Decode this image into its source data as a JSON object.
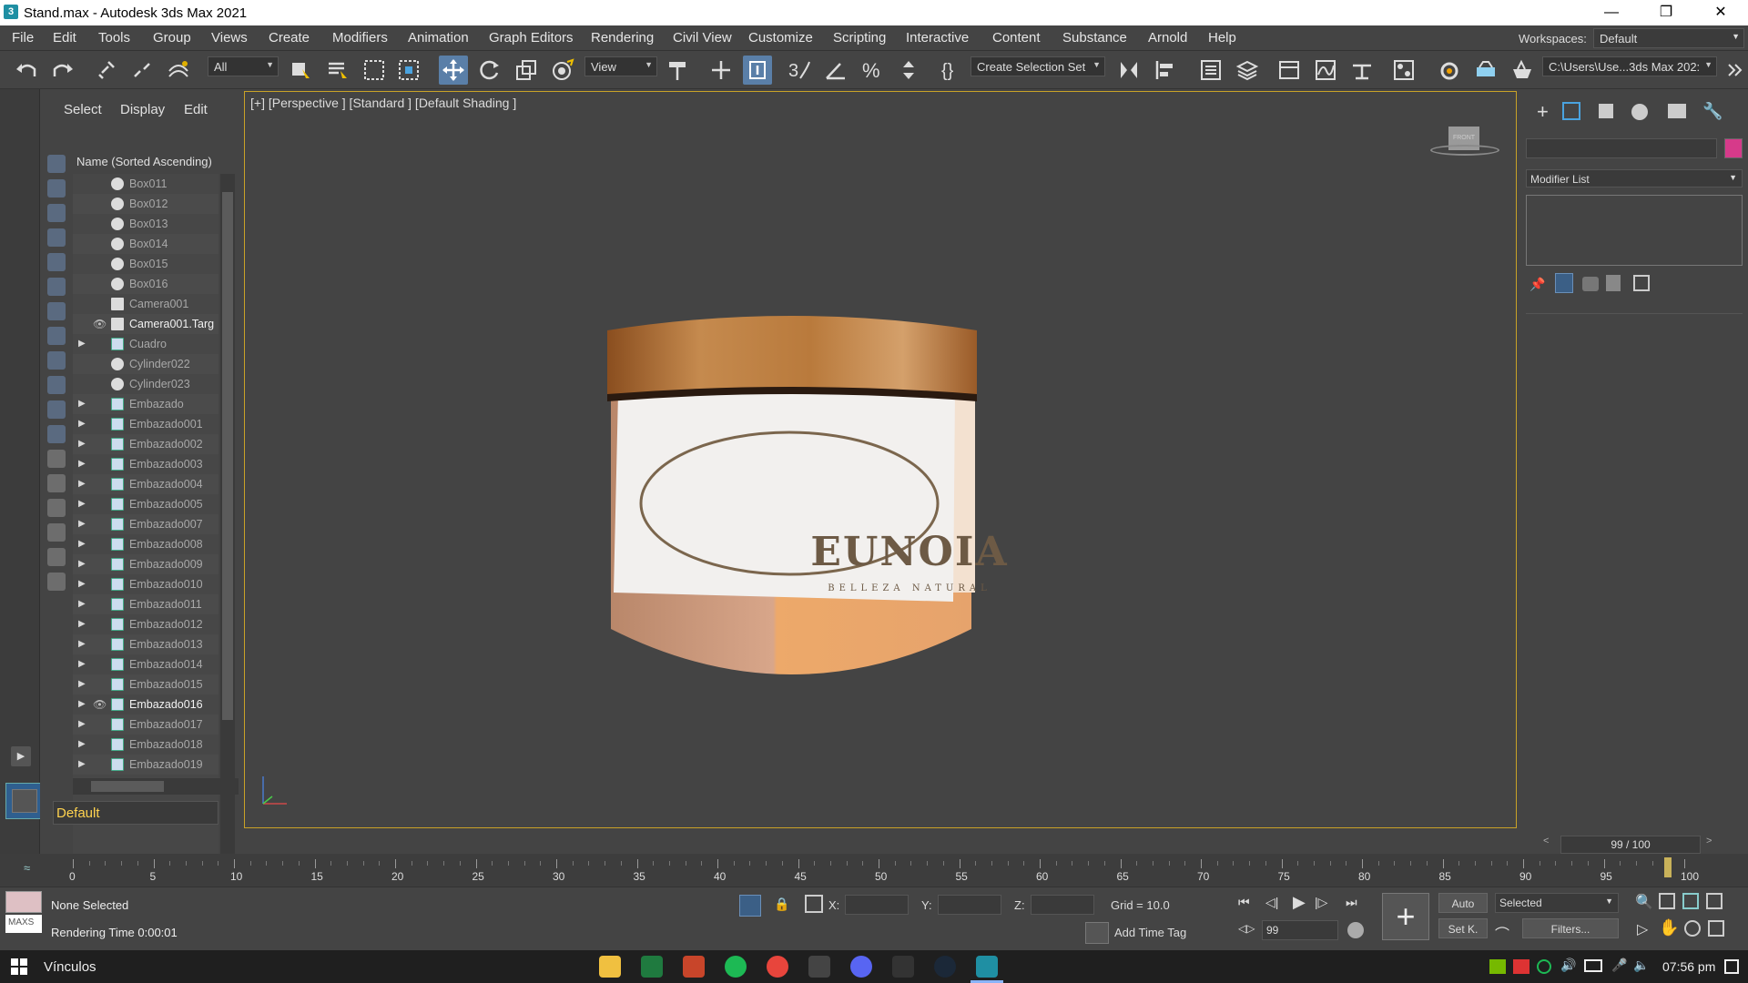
{
  "window": {
    "title": "Stand.max - Autodesk 3ds Max 2021",
    "app_icon": "3"
  },
  "menu": [
    "File",
    "Edit",
    "Tools",
    "Group",
    "Views",
    "Create",
    "Modifiers",
    "Animation",
    "Graph Editors",
    "Rendering",
    "Civil View",
    "Customize",
    "Scripting",
    "Interactive",
    "Content",
    "Substance",
    "Arnold",
    "Help"
  ],
  "workspaces": {
    "label": "Workspaces:",
    "value": "Default"
  },
  "toolbar": {
    "filter": "All",
    "ref_coord": "View",
    "selection_set": "Create Selection Set",
    "project_path": "C:\\Users\\Use...3ds Max 202:"
  },
  "explorer": {
    "tabs": [
      "Select",
      "Display",
      "Edit"
    ],
    "header": "Name (Sorted Ascending)",
    "items": [
      {
        "name": "Box011",
        "icon": "sphere",
        "expand": false,
        "eye": false
      },
      {
        "name": "Box012",
        "icon": "sphere",
        "expand": false,
        "eye": false
      },
      {
        "name": "Box013",
        "icon": "sphere",
        "expand": false,
        "eye": false
      },
      {
        "name": "Box014",
        "icon": "sphere",
        "expand": false,
        "eye": false
      },
      {
        "name": "Box015",
        "icon": "sphere",
        "expand": false,
        "eye": false
      },
      {
        "name": "Box016",
        "icon": "sphere",
        "expand": false,
        "eye": false
      },
      {
        "name": "Camera001",
        "icon": "camera",
        "expand": false,
        "eye": false
      },
      {
        "name": "Camera001.Targ",
        "icon": "camera",
        "expand": false,
        "eye": true
      },
      {
        "name": "Cuadro",
        "icon": "group",
        "expand": true,
        "eye": false
      },
      {
        "name": "Cylinder022",
        "icon": "sphere",
        "expand": false,
        "eye": false
      },
      {
        "name": "Cylinder023",
        "icon": "sphere",
        "expand": false,
        "eye": false
      },
      {
        "name": "Embazado",
        "icon": "group",
        "expand": true,
        "eye": false
      },
      {
        "name": "Embazado001",
        "icon": "group",
        "expand": true,
        "eye": false
      },
      {
        "name": "Embazado002",
        "icon": "group",
        "expand": true,
        "eye": false
      },
      {
        "name": "Embazado003",
        "icon": "group",
        "expand": true,
        "eye": false
      },
      {
        "name": "Embazado004",
        "icon": "group",
        "expand": true,
        "eye": false
      },
      {
        "name": "Embazado005",
        "icon": "group",
        "expand": true,
        "eye": false
      },
      {
        "name": "Embazado007",
        "icon": "group",
        "expand": true,
        "eye": false
      },
      {
        "name": "Embazado008",
        "icon": "group",
        "expand": true,
        "eye": false
      },
      {
        "name": "Embazado009",
        "icon": "group",
        "expand": true,
        "eye": false
      },
      {
        "name": "Embazado010",
        "icon": "group",
        "expand": true,
        "eye": false
      },
      {
        "name": "Embazado011",
        "icon": "group",
        "expand": true,
        "eye": false
      },
      {
        "name": "Embazado012",
        "icon": "group",
        "expand": true,
        "eye": false
      },
      {
        "name": "Embazado013",
        "icon": "group",
        "expand": true,
        "eye": false
      },
      {
        "name": "Embazado014",
        "icon": "group",
        "expand": true,
        "eye": false
      },
      {
        "name": "Embazado015",
        "icon": "group",
        "expand": true,
        "eye": false
      },
      {
        "name": "Embazado016",
        "icon": "group",
        "expand": true,
        "eye": true
      },
      {
        "name": "Embazado017",
        "icon": "group",
        "expand": true,
        "eye": false
      },
      {
        "name": "Embazado018",
        "icon": "group",
        "expand": true,
        "eye": false
      },
      {
        "name": "Embazado019",
        "icon": "group",
        "expand": true,
        "eye": false
      }
    ],
    "layer": "Default"
  },
  "viewport": {
    "label": "[+] [Perspective ] [Standard ] [Default Shading ]",
    "viewcube": "FRONT",
    "product": {
      "brand": "EUNOIA",
      "tagline": "BELLEZA NATURAL"
    }
  },
  "cmdpanel": {
    "modifier_list": "Modifier List",
    "name_color": "#d63a8a"
  },
  "timeline": {
    "frame_display": "99 / 100",
    "ticks": [
      "0",
      "5",
      "10",
      "15",
      "20",
      "25",
      "30",
      "35",
      "40",
      "45",
      "50",
      "55",
      "60",
      "65",
      "70",
      "75",
      "80",
      "85",
      "90",
      "95",
      "100"
    ],
    "current_frame": 99,
    "max_frame": 100
  },
  "status": {
    "maxscript": "MAXS",
    "selection": "None Selected",
    "render_time": "Rendering Time  0:00:01",
    "x_label": "X:",
    "y_label": "Y:",
    "z_label": "Z:",
    "grid": "Grid = 10.0",
    "add_time_tag": "Add Time Tag",
    "frame_field": "99",
    "auto": "Auto",
    "setkey": "Set K.",
    "key_filter": "Selected",
    "filters": "Filters..."
  },
  "taskbar": {
    "search_text": "Vínculos",
    "time": "07:56 pm"
  }
}
